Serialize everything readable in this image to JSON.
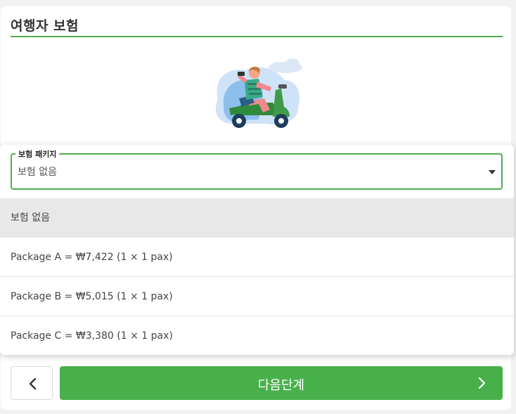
{
  "section": {
    "title": "여행자 보험"
  },
  "illustration": {
    "icon": "scooter-rider-illustration"
  },
  "insurance_select": {
    "legend": "보험 패키지",
    "value": "보험 없음",
    "options": [
      {
        "label": "보험 없음",
        "selected": true
      },
      {
        "label": "Package A = ₩7,422 (1 × 1 pax)",
        "selected": false
      },
      {
        "label": "Package B = ₩5,015 (1 × 1 pax)",
        "selected": false
      },
      {
        "label": "Package C = ₩3,380 (1 × 1 pax)",
        "selected": false
      }
    ]
  },
  "footer": {
    "back_icon": "chevron-left-icon",
    "next_label": "다음단계",
    "next_icon": "chevron-right-icon"
  },
  "colors": {
    "accent": "#4cae4c",
    "button_green": "#48b04b",
    "selected_option_bg": "#e8e8e8"
  }
}
